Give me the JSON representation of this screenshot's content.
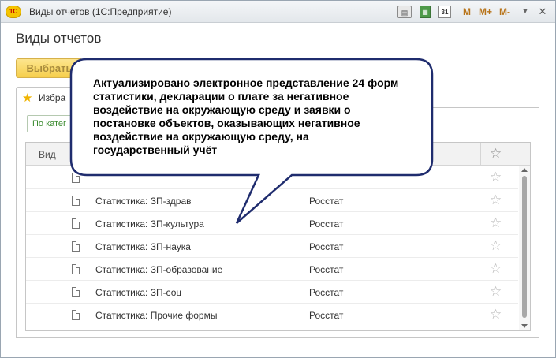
{
  "window": {
    "logo": "1С",
    "title": "Виды отчетов  (1С:Предприятие)",
    "toolbar": {
      "calendar_label": "31",
      "m_label": "M",
      "m_plus_label": "M+",
      "m_minus_label": "M-",
      "icons": [
        "print-icon",
        "calculator-icon",
        "calendar-icon",
        "menu-icon",
        "close-icon"
      ]
    }
  },
  "page": {
    "title": "Виды отчетов",
    "select_button": "Выбрать"
  },
  "tabs": {
    "favorites_label": "Избра"
  },
  "filter": {
    "label": "По катег"
  },
  "grid": {
    "header": {
      "vid": "Вид"
    },
    "rows": [
      {
        "name": "Статистика: ЗП-здрав",
        "org": "Росстат"
      },
      {
        "name": "Статистика: ЗП-культура",
        "org": "Росстат"
      },
      {
        "name": "Статистика: ЗП-наука",
        "org": "Росстат"
      },
      {
        "name": "Статистика: ЗП-образование",
        "org": "Росстат"
      },
      {
        "name": "Статистика: ЗП-соц",
        "org": "Росстат"
      },
      {
        "name": "Статистика: Прочие формы",
        "org": "Росстат"
      }
    ]
  },
  "callout": {
    "text": "Актуализировано электронное представление 24 форм статистики,  декларации о плате за негативное воздействие на окружающую среду и заявки о постановке объектов, оказывающих негативное воздействие на окружающую среду, на государственный учёт",
    "fill_color": "#ffffff",
    "border_color": "#1f2c6e"
  },
  "colors": {
    "accent_yellow": "#f6cf4c",
    "star_yellow": "#f0b400",
    "filter_green": "#3a8a2e"
  }
}
